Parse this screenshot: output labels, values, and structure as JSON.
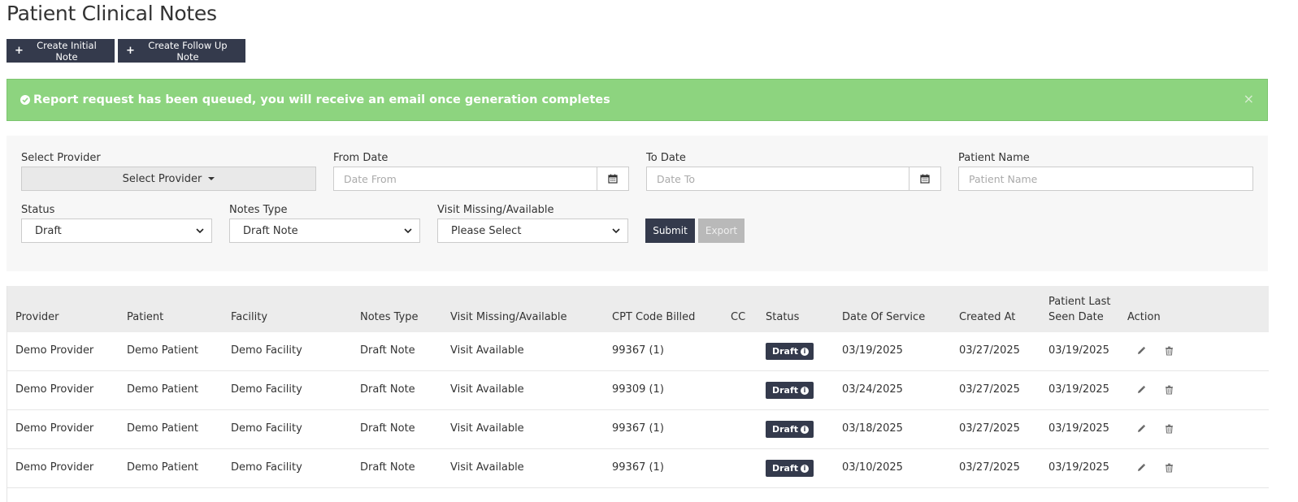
{
  "page": {
    "title": "Patient Clinical Notes"
  },
  "toolbar": {
    "create_initial_label": "Create Initial Note",
    "create_followup_label": "Create Follow Up Note"
  },
  "alert": {
    "message": "Report request has been queued, you will receive an email once generation completes",
    "close_symbol": "×",
    "color": "#8dd47f"
  },
  "filters": {
    "provider": {
      "label": "Select Provider",
      "value": "Select Provider"
    },
    "from_date": {
      "label": "From Date",
      "placeholder": "Date From"
    },
    "to_date": {
      "label": "To Date",
      "placeholder": "Date To"
    },
    "patient_name": {
      "label": "Patient Name",
      "placeholder": "Patient Name"
    },
    "status": {
      "label": "Status",
      "value": "Draft"
    },
    "notes_type": {
      "label": "Notes Type",
      "value": "Draft Note"
    },
    "visit": {
      "label": "Visit Missing/Available",
      "value": "Please Select"
    },
    "submit_label": "Submit",
    "export_label": "Export"
  },
  "table": {
    "headers": {
      "provider": "Provider",
      "patient": "Patient",
      "facility": "Facility",
      "notes_type": "Notes Type",
      "visit": "Visit Missing/Available",
      "cpt": "CPT Code Billed",
      "cc": "CC",
      "status": "Status",
      "dos": "Date Of Service",
      "created": "Created At",
      "last_seen_1": "Patient Last",
      "last_seen_2": "Seen Date",
      "action": "Action"
    },
    "rows": [
      {
        "provider": "Demo Provider",
        "patient": "Demo Patient",
        "facility": "Demo Facility",
        "notes_type": "Draft Note",
        "visit": "Visit Available",
        "cpt": "99367 (1)",
        "cc": "",
        "status": "Draft",
        "dos": "03/19/2025",
        "created": "03/27/2025",
        "last_seen": "03/19/2025"
      },
      {
        "provider": "Demo Provider",
        "patient": "Demo Patient",
        "facility": "Demo Facility",
        "notes_type": "Draft Note",
        "visit": "Visit Available",
        "cpt": "99309 (1)",
        "cc": "",
        "status": "Draft",
        "dos": "03/24/2025",
        "created": "03/27/2025",
        "last_seen": "03/19/2025"
      },
      {
        "provider": "Demo Provider",
        "patient": "Demo Patient",
        "facility": "Demo Facility",
        "notes_type": "Draft Note",
        "visit": "Visit Available",
        "cpt": "99367 (1)",
        "cc": "",
        "status": "Draft",
        "dos": "03/18/2025",
        "created": "03/27/2025",
        "last_seen": "03/19/2025"
      },
      {
        "provider": "Demo Provider",
        "patient": "Demo Patient",
        "facility": "Demo Facility",
        "notes_type": "Draft Note",
        "visit": "Visit Available",
        "cpt": "99367 (1)",
        "cc": "",
        "status": "Draft",
        "dos": "03/10/2025",
        "created": "03/27/2025",
        "last_seen": "03/19/2025"
      }
    ]
  },
  "icons": {
    "plus": "plus-icon",
    "check": "check-circle-icon",
    "calendar": "calendar-icon",
    "edit": "pencil-icon",
    "delete": "trash-icon",
    "info": "info-icon"
  },
  "colors": {
    "primary_dark": "#343a4c",
    "success": "#8dd47f",
    "export_disabled": "#b9b9b9"
  }
}
